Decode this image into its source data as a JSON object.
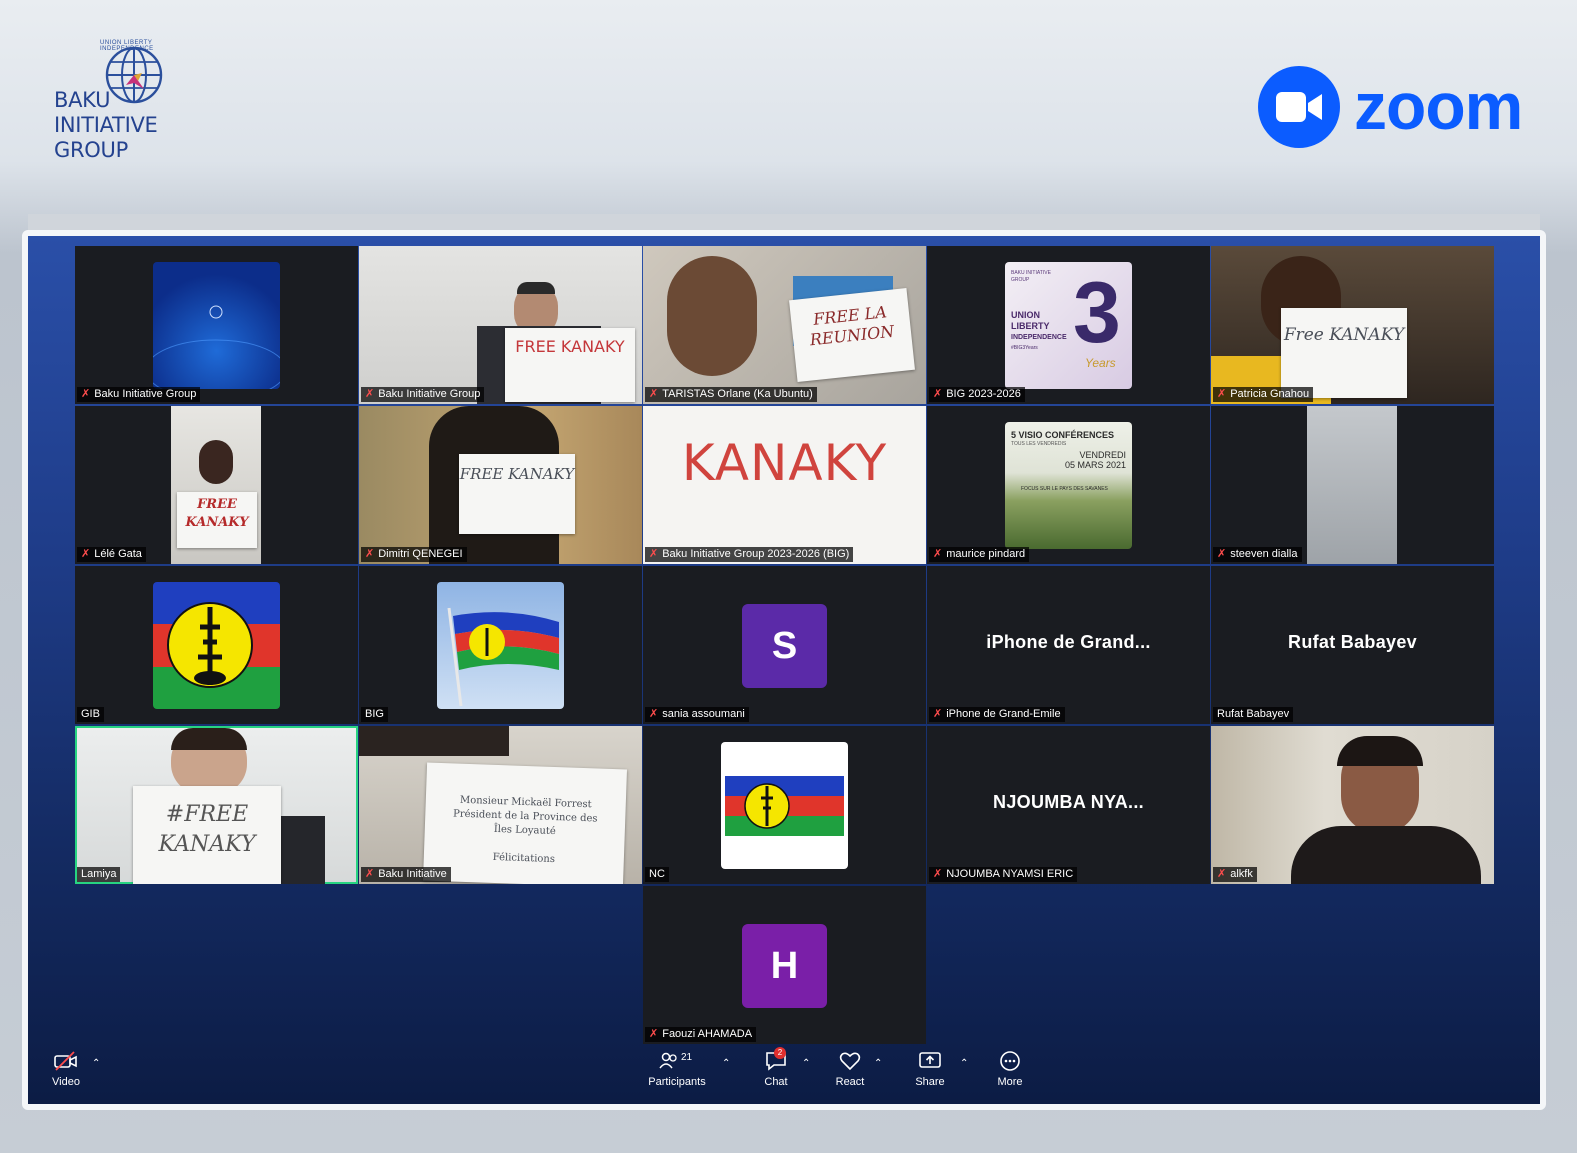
{
  "header": {
    "baku_logo": {
      "arc_text": "UNION LIBERTY INDEPENDENCE",
      "line1": "BAKU",
      "line2": "INITIATIVE",
      "line3": "GROUP"
    },
    "zoom_logo": {
      "word": "zoom",
      "color": "#0b5cff"
    }
  },
  "gallery": {
    "tiles": [
      {
        "name": "Baku Initiative Group",
        "muted": true
      },
      {
        "name": "Baku Initiative Group",
        "muted": true,
        "sign": "FREE KANAKY"
      },
      {
        "name": "TARISTAS Orlane (Ka Ubuntu)",
        "muted": true,
        "sign": "FREE LA REUNION"
      },
      {
        "name": "BIG 2023-2026",
        "muted": true,
        "poster": {
          "lines": [
            "BAKU INITIATIVE GROUP",
            "UNION",
            "LIBERTY",
            "INDEPENDENCE",
            "#BIG3Years"
          ],
          "big": "3",
          "sub": "Years"
        }
      },
      {
        "name": "Patricia Gnahou",
        "muted": true,
        "sign": "Free KANAKY"
      },
      {
        "name": "Lélé Gata",
        "muted": true,
        "sign": "FREE KANAKY"
      },
      {
        "name": "Dimitri QENEGEI",
        "muted": true,
        "sign": "FREE KANAKY"
      },
      {
        "name": "Baku Initiative Group 2023-2026 (BIG)",
        "muted": true,
        "sign": "KANAKY"
      },
      {
        "name": "maurice pindard",
        "muted": true,
        "poster": {
          "lines": [
            "5 VISIO CONFÉRENCES",
            "TOUS LES VENDREDIS",
            "VENDREDI",
            "05 MARS 2021",
            "FOCUS SUR LE PAYS DES SAVANES"
          ]
        }
      },
      {
        "name": "steeven dialla",
        "muted": true
      },
      {
        "name": "GIB",
        "muted": false
      },
      {
        "name": "BIG",
        "muted": false
      },
      {
        "name": "sania assoumani",
        "muted": true,
        "avatar": "S",
        "avatar_color": "#5b2aa8"
      },
      {
        "name": "iPhone de Grand-Emile",
        "muted": true,
        "display": "iPhone de Grand..."
      },
      {
        "name": "Rufat Babayev",
        "muted": false,
        "display": "Rufat Babayev"
      },
      {
        "name": "Lamiya",
        "muted": false,
        "speaking": true,
        "sign": "#FREE KANAKY"
      },
      {
        "name": "Baku Initiative",
        "muted": true,
        "letter": [
          "Monsieur Mickaël Forrest",
          "Président de la Province des",
          "Îles Loyauté",
          "Félicitations"
        ]
      },
      {
        "name": "NC",
        "muted": false
      },
      {
        "name": "NJOUMBA NYAMSI ERIC",
        "muted": true,
        "display": "NJOUMBA  NYA..."
      },
      {
        "name": "alkfk",
        "muted": true
      },
      {
        "name": "Faouzi AHAMADA",
        "muted": true,
        "avatar": "H",
        "avatar_color": "#7a1fa8"
      }
    ]
  },
  "toolbar": {
    "video": "Video",
    "participants": "Participants",
    "participants_count": "21",
    "chat": "Chat",
    "chat_badge": "2",
    "react": "React",
    "share": "Share",
    "more": "More"
  }
}
